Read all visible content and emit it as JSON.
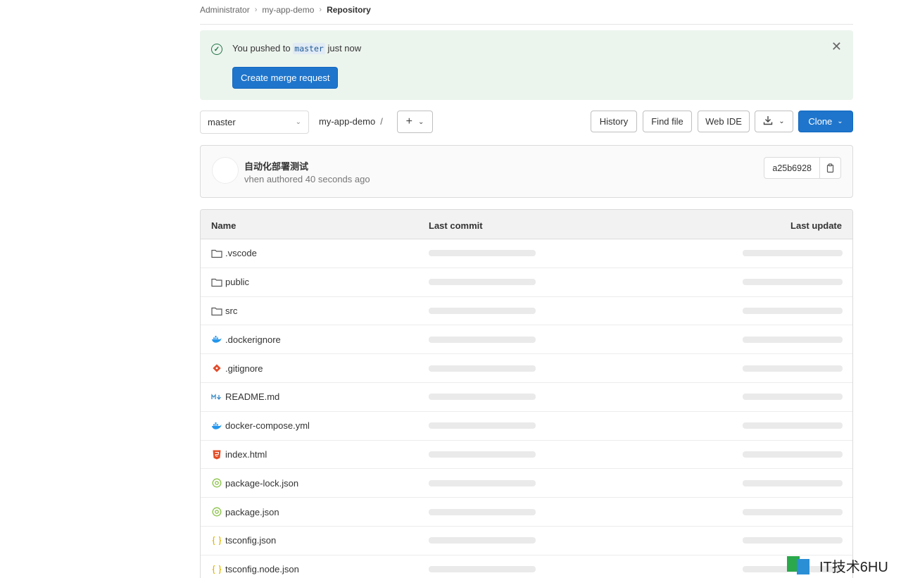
{
  "breadcrumb": {
    "items": [
      "Administrator",
      "my-app-demo",
      "Repository"
    ]
  },
  "alert": {
    "message_prefix": "You pushed to",
    "branch": "master",
    "message_suffix": "just now",
    "button_label": "Create merge request",
    "close_icon": "close-icon"
  },
  "toolbar": {
    "branch": "master",
    "repo_name": "my-app-demo",
    "separator": "/",
    "history": "History",
    "find_file": "Find file",
    "web_ide": "Web IDE",
    "clone": "Clone",
    "accent": "#1f75cb"
  },
  "commit": {
    "title": "自动化部署测试",
    "author": "vhen",
    "authored": "authored",
    "time": "40 seconds ago",
    "sha": "a25b6928"
  },
  "table": {
    "headers": [
      "Name",
      "Last commit",
      "Last update"
    ],
    "files": [
      {
        "name": ".vscode",
        "icon": "folder-icon"
      },
      {
        "name": "public",
        "icon": "folder-icon"
      },
      {
        "name": "src",
        "icon": "folder-icon"
      },
      {
        "name": ".dockerignore",
        "icon": "docker-icon"
      },
      {
        "name": ".gitignore",
        "icon": "git-icon"
      },
      {
        "name": "README.md",
        "icon": "markdown-icon"
      },
      {
        "name": "docker-compose.yml",
        "icon": "docker-icon"
      },
      {
        "name": "index.html",
        "icon": "html5-icon"
      },
      {
        "name": "package-lock.json",
        "icon": "npm-icon"
      },
      {
        "name": "package.json",
        "icon": "npm-icon"
      },
      {
        "name": "tsconfig.json",
        "icon": "json-icon"
      },
      {
        "name": "tsconfig.node.json",
        "icon": "json-icon"
      }
    ]
  },
  "watermark": {
    "text": "IT技术6HU"
  }
}
